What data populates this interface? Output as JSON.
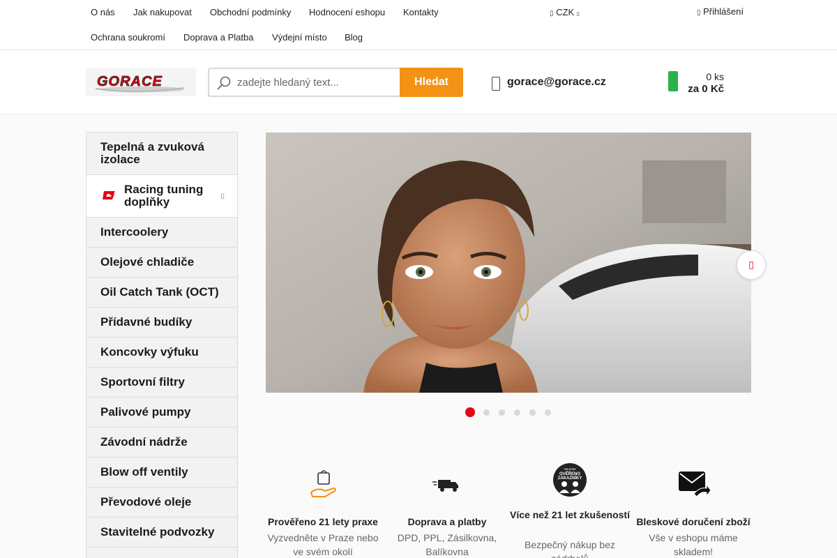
{
  "topnav": {
    "links_row1": [
      "O nás",
      "Jak nakupovat",
      "Obchodní podmínky",
      "Hodnocení eshopu",
      "Kontakty"
    ],
    "links_row2": [
      "Ochrana soukromí",
      "Doprava a Platba",
      "Výdejní místo",
      "Blog"
    ],
    "currency": "CZK",
    "login": "Přihlášení"
  },
  "header": {
    "logo_text": "GORACE",
    "search_placeholder": "zadejte hledaný text...",
    "search_button": "Hledat",
    "email": "gorace@gorace.cz",
    "cart_count": "0 ks",
    "cart_total": "za 0 Kč"
  },
  "sidebar": {
    "categories": [
      "Tepelná a zvuková izolace",
      "Racing tuning doplňky",
      "Intercoolery",
      "Olejové chladiče",
      "Oil Catch Tank (OCT)",
      "Přídavné budíky",
      "Koncovky výfuku",
      "Sportovní filtry",
      "Palivové pumpy",
      "Závodní nádrže",
      "Blow off ventily",
      "Převodové oleje",
      "Stavitelné podvozky"
    ]
  },
  "slider": {
    "slides": 6,
    "active_slide": 1
  },
  "benefits": [
    {
      "title": "Prověřeno 21 lety praxe",
      "desc": "Vyzvedněte v Praze nebo ve svém okolí",
      "icon": "hand-bag-icon"
    },
    {
      "title": "Doprava a platby",
      "desc": "DPD, PPL, Zásilkovna, Balíkovna",
      "icon": "delivery-truck-icon"
    },
    {
      "title": "Více než 21 let zkušeností",
      "desc": "Bezpečný nákup bez zádrhelů",
      "icon": "verified-badge-icon",
      "badge_line1": "Heureka",
      "badge_line2": "OVĚŘENO",
      "badge_line3": "ZÁKAZNÍKY"
    },
    {
      "title": "Bleskové doručení zboží",
      "desc": "Vše v eshopu máme skladem!",
      "icon": "mail-forward-icon"
    }
  ],
  "colors": {
    "accent_orange": "#f39214",
    "brand_red": "#e30613",
    "cart_green": "#2ab24a"
  }
}
